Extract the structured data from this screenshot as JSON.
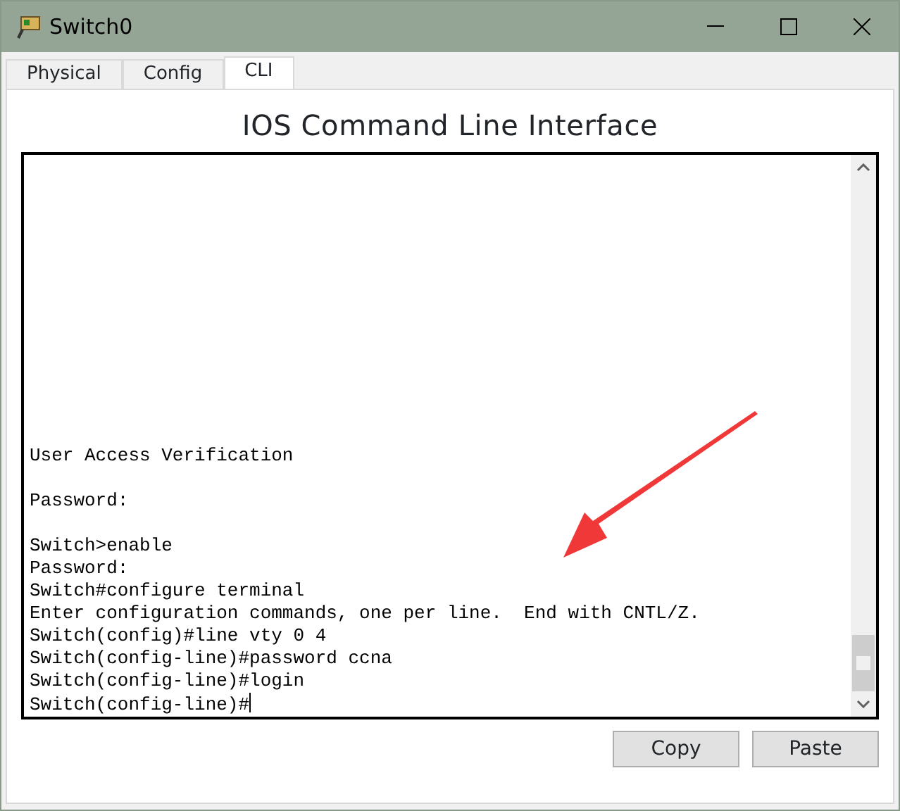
{
  "window": {
    "title": "Switch0"
  },
  "tabs": [
    {
      "label": "Physical",
      "selected": false
    },
    {
      "label": "Config",
      "selected": false
    },
    {
      "label": "CLI",
      "selected": true
    }
  ],
  "heading": "IOS Command Line Interface",
  "terminal": {
    "lines": [
      {
        "text": "User Access Verification",
        "blank_before": false
      },
      {
        "text": "Password:",
        "blank_before": true
      },
      {
        "text": "Switch>enable",
        "blank_before": true
      },
      {
        "text": "Password:",
        "blank_before": false
      },
      {
        "text": "Switch#configure terminal",
        "blank_before": false
      },
      {
        "text": "Enter configuration commands, one per line.  End with CNTL/Z.",
        "blank_before": false
      },
      {
        "text": "Switch(config)#line vty 0 4",
        "blank_before": false
      },
      {
        "text": "Switch(config-line)#password ccna",
        "blank_before": false
      },
      {
        "text": "Switch(config-line)#login",
        "blank_before": false
      },
      {
        "text": "Switch(config-line)#",
        "blank_before": false,
        "cursor": true
      }
    ]
  },
  "buttons": [
    "Copy",
    "Paste"
  ]
}
